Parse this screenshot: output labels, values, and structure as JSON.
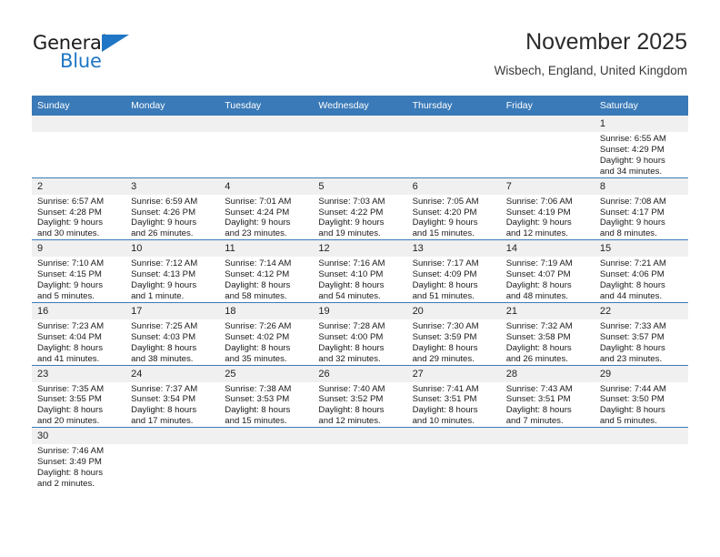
{
  "brand": {
    "name_part1": "General",
    "name_part2": "Blue",
    "accent_color": "#1f76c4"
  },
  "header": {
    "title": "November 2025",
    "location": "Wisbech, England, United Kingdom"
  },
  "theme": {
    "header_row_color": "#3a7ab8",
    "daynum_band_color": "#f0f0f0",
    "text_color": "#1a1a1a"
  },
  "weekdays": [
    "Sunday",
    "Monday",
    "Tuesday",
    "Wednesday",
    "Thursday",
    "Friday",
    "Saturday"
  ],
  "weeks": [
    [
      {
        "day": "",
        "sunrise": "",
        "sunset": "",
        "daylight1": "",
        "daylight2": "",
        "empty": true
      },
      {
        "day": "",
        "sunrise": "",
        "sunset": "",
        "daylight1": "",
        "daylight2": "",
        "empty": true
      },
      {
        "day": "",
        "sunrise": "",
        "sunset": "",
        "daylight1": "",
        "daylight2": "",
        "empty": true
      },
      {
        "day": "",
        "sunrise": "",
        "sunset": "",
        "daylight1": "",
        "daylight2": "",
        "empty": true
      },
      {
        "day": "",
        "sunrise": "",
        "sunset": "",
        "daylight1": "",
        "daylight2": "",
        "empty": true
      },
      {
        "day": "",
        "sunrise": "",
        "sunset": "",
        "daylight1": "",
        "daylight2": "",
        "empty": true
      },
      {
        "day": "1",
        "sunrise": "Sunrise: 6:55 AM",
        "sunset": "Sunset: 4:29 PM",
        "daylight1": "Daylight: 9 hours",
        "daylight2": "and 34 minutes.",
        "empty": false
      }
    ],
    [
      {
        "day": "2",
        "sunrise": "Sunrise: 6:57 AM",
        "sunset": "Sunset: 4:28 PM",
        "daylight1": "Daylight: 9 hours",
        "daylight2": "and 30 minutes.",
        "empty": false
      },
      {
        "day": "3",
        "sunrise": "Sunrise: 6:59 AM",
        "sunset": "Sunset: 4:26 PM",
        "daylight1": "Daylight: 9 hours",
        "daylight2": "and 26 minutes.",
        "empty": false
      },
      {
        "day": "4",
        "sunrise": "Sunrise: 7:01 AM",
        "sunset": "Sunset: 4:24 PM",
        "daylight1": "Daylight: 9 hours",
        "daylight2": "and 23 minutes.",
        "empty": false
      },
      {
        "day": "5",
        "sunrise": "Sunrise: 7:03 AM",
        "sunset": "Sunset: 4:22 PM",
        "daylight1": "Daylight: 9 hours",
        "daylight2": "and 19 minutes.",
        "empty": false
      },
      {
        "day": "6",
        "sunrise": "Sunrise: 7:05 AM",
        "sunset": "Sunset: 4:20 PM",
        "daylight1": "Daylight: 9 hours",
        "daylight2": "and 15 minutes.",
        "empty": false
      },
      {
        "day": "7",
        "sunrise": "Sunrise: 7:06 AM",
        "sunset": "Sunset: 4:19 PM",
        "daylight1": "Daylight: 9 hours",
        "daylight2": "and 12 minutes.",
        "empty": false
      },
      {
        "day": "8",
        "sunrise": "Sunrise: 7:08 AM",
        "sunset": "Sunset: 4:17 PM",
        "daylight1": "Daylight: 9 hours",
        "daylight2": "and 8 minutes.",
        "empty": false
      }
    ],
    [
      {
        "day": "9",
        "sunrise": "Sunrise: 7:10 AM",
        "sunset": "Sunset: 4:15 PM",
        "daylight1": "Daylight: 9 hours",
        "daylight2": "and 5 minutes.",
        "empty": false
      },
      {
        "day": "10",
        "sunrise": "Sunrise: 7:12 AM",
        "sunset": "Sunset: 4:13 PM",
        "daylight1": "Daylight: 9 hours",
        "daylight2": "and 1 minute.",
        "empty": false
      },
      {
        "day": "11",
        "sunrise": "Sunrise: 7:14 AM",
        "sunset": "Sunset: 4:12 PM",
        "daylight1": "Daylight: 8 hours",
        "daylight2": "and 58 minutes.",
        "empty": false
      },
      {
        "day": "12",
        "sunrise": "Sunrise: 7:16 AM",
        "sunset": "Sunset: 4:10 PM",
        "daylight1": "Daylight: 8 hours",
        "daylight2": "and 54 minutes.",
        "empty": false
      },
      {
        "day": "13",
        "sunrise": "Sunrise: 7:17 AM",
        "sunset": "Sunset: 4:09 PM",
        "daylight1": "Daylight: 8 hours",
        "daylight2": "and 51 minutes.",
        "empty": false
      },
      {
        "day": "14",
        "sunrise": "Sunrise: 7:19 AM",
        "sunset": "Sunset: 4:07 PM",
        "daylight1": "Daylight: 8 hours",
        "daylight2": "and 48 minutes.",
        "empty": false
      },
      {
        "day": "15",
        "sunrise": "Sunrise: 7:21 AM",
        "sunset": "Sunset: 4:06 PM",
        "daylight1": "Daylight: 8 hours",
        "daylight2": "and 44 minutes.",
        "empty": false
      }
    ],
    [
      {
        "day": "16",
        "sunrise": "Sunrise: 7:23 AM",
        "sunset": "Sunset: 4:04 PM",
        "daylight1": "Daylight: 8 hours",
        "daylight2": "and 41 minutes.",
        "empty": false
      },
      {
        "day": "17",
        "sunrise": "Sunrise: 7:25 AM",
        "sunset": "Sunset: 4:03 PM",
        "daylight1": "Daylight: 8 hours",
        "daylight2": "and 38 minutes.",
        "empty": false
      },
      {
        "day": "18",
        "sunrise": "Sunrise: 7:26 AM",
        "sunset": "Sunset: 4:02 PM",
        "daylight1": "Daylight: 8 hours",
        "daylight2": "and 35 minutes.",
        "empty": false
      },
      {
        "day": "19",
        "sunrise": "Sunrise: 7:28 AM",
        "sunset": "Sunset: 4:00 PM",
        "daylight1": "Daylight: 8 hours",
        "daylight2": "and 32 minutes.",
        "empty": false
      },
      {
        "day": "20",
        "sunrise": "Sunrise: 7:30 AM",
        "sunset": "Sunset: 3:59 PM",
        "daylight1": "Daylight: 8 hours",
        "daylight2": "and 29 minutes.",
        "empty": false
      },
      {
        "day": "21",
        "sunrise": "Sunrise: 7:32 AM",
        "sunset": "Sunset: 3:58 PM",
        "daylight1": "Daylight: 8 hours",
        "daylight2": "and 26 minutes.",
        "empty": false
      },
      {
        "day": "22",
        "sunrise": "Sunrise: 7:33 AM",
        "sunset": "Sunset: 3:57 PM",
        "daylight1": "Daylight: 8 hours",
        "daylight2": "and 23 minutes.",
        "empty": false
      }
    ],
    [
      {
        "day": "23",
        "sunrise": "Sunrise: 7:35 AM",
        "sunset": "Sunset: 3:55 PM",
        "daylight1": "Daylight: 8 hours",
        "daylight2": "and 20 minutes.",
        "empty": false
      },
      {
        "day": "24",
        "sunrise": "Sunrise: 7:37 AM",
        "sunset": "Sunset: 3:54 PM",
        "daylight1": "Daylight: 8 hours",
        "daylight2": "and 17 minutes.",
        "empty": false
      },
      {
        "day": "25",
        "sunrise": "Sunrise: 7:38 AM",
        "sunset": "Sunset: 3:53 PM",
        "daylight1": "Daylight: 8 hours",
        "daylight2": "and 15 minutes.",
        "empty": false
      },
      {
        "day": "26",
        "sunrise": "Sunrise: 7:40 AM",
        "sunset": "Sunset: 3:52 PM",
        "daylight1": "Daylight: 8 hours",
        "daylight2": "and 12 minutes.",
        "empty": false
      },
      {
        "day": "27",
        "sunrise": "Sunrise: 7:41 AM",
        "sunset": "Sunset: 3:51 PM",
        "daylight1": "Daylight: 8 hours",
        "daylight2": "and 10 minutes.",
        "empty": false
      },
      {
        "day": "28",
        "sunrise": "Sunrise: 7:43 AM",
        "sunset": "Sunset: 3:51 PM",
        "daylight1": "Daylight: 8 hours",
        "daylight2": "and 7 minutes.",
        "empty": false
      },
      {
        "day": "29",
        "sunrise": "Sunrise: 7:44 AM",
        "sunset": "Sunset: 3:50 PM",
        "daylight1": "Daylight: 8 hours",
        "daylight2": "and 5 minutes.",
        "empty": false
      }
    ],
    [
      {
        "day": "30",
        "sunrise": "Sunrise: 7:46 AM",
        "sunset": "Sunset: 3:49 PM",
        "daylight1": "Daylight: 8 hours",
        "daylight2": "and 2 minutes.",
        "empty": false
      },
      {
        "day": "",
        "sunrise": "",
        "sunset": "",
        "daylight1": "",
        "daylight2": "",
        "empty": true
      },
      {
        "day": "",
        "sunrise": "",
        "sunset": "",
        "daylight1": "",
        "daylight2": "",
        "empty": true
      },
      {
        "day": "",
        "sunrise": "",
        "sunset": "",
        "daylight1": "",
        "daylight2": "",
        "empty": true
      },
      {
        "day": "",
        "sunrise": "",
        "sunset": "",
        "daylight1": "",
        "daylight2": "",
        "empty": true
      },
      {
        "day": "",
        "sunrise": "",
        "sunset": "",
        "daylight1": "",
        "daylight2": "",
        "empty": true
      },
      {
        "day": "",
        "sunrise": "",
        "sunset": "",
        "daylight1": "",
        "daylight2": "",
        "empty": true
      }
    ]
  ]
}
